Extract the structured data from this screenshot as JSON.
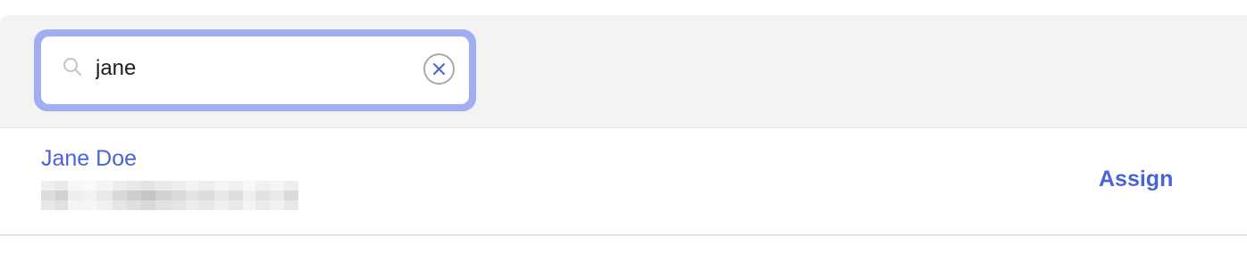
{
  "search": {
    "value": "jane",
    "icon": "search-icon",
    "clear_icon": "close-circle-icon"
  },
  "results": [
    {
      "name": "Jane Doe",
      "action_label": "Assign"
    }
  ],
  "colors": {
    "accent": "#4a63d8",
    "focus_ring": "#a2aef2",
    "header_bg": "#f3f3f3"
  }
}
